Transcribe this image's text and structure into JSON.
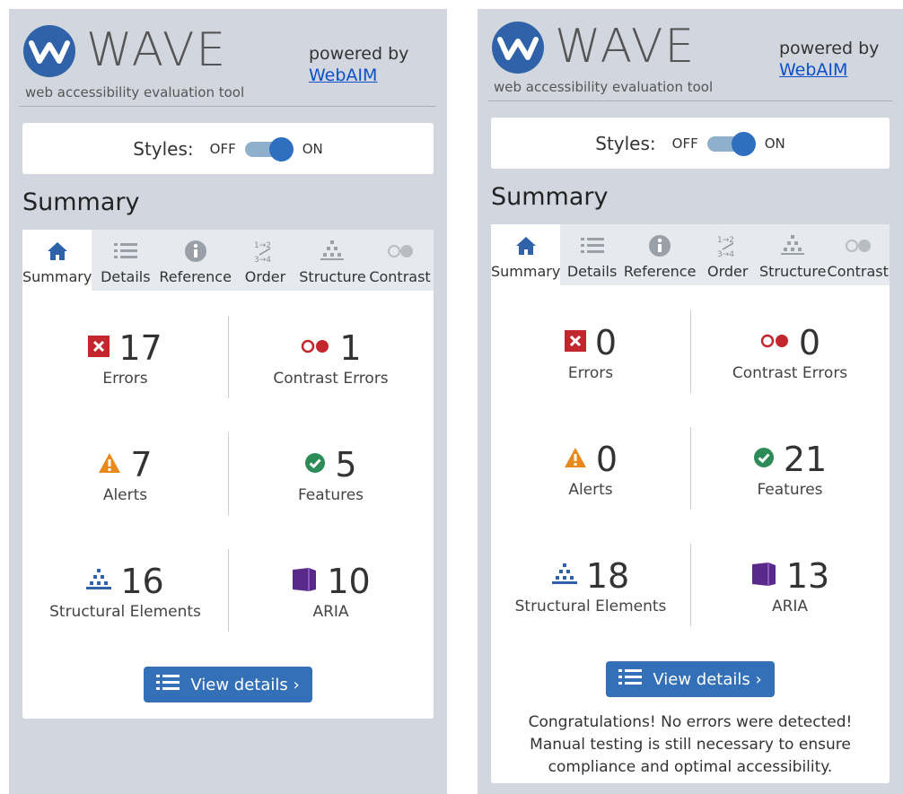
{
  "branding": {
    "logo_text": "WAVE",
    "tagline": "web accessibility evaluation tool",
    "powered_by": "powered by",
    "webaim_link": "WebAIM"
  },
  "styles_toggle": {
    "label": "Styles:",
    "off": "OFF",
    "on": "ON",
    "state": "on"
  },
  "summary_heading": "Summary",
  "tabs": [
    {
      "label": "Summary",
      "icon": "home-icon",
      "active": true
    },
    {
      "label": "Details",
      "icon": "list-icon"
    },
    {
      "label": "Reference",
      "icon": "info-icon"
    },
    {
      "label": "Order",
      "icon": "order-icon"
    },
    {
      "label": "Structure",
      "icon": "structure-icon"
    },
    {
      "label": "Contrast",
      "icon": "contrast-icon"
    }
  ],
  "colors": {
    "accent": "#3470b8",
    "error": "#c4262e",
    "alert": "#e8891d",
    "feature": "#2d8b57",
    "aria": "#5a2a8a",
    "structure": "#2f62a8"
  },
  "before": {
    "errors": {
      "count": "17",
      "label": "Errors"
    },
    "contrast": {
      "count": "1",
      "label": "Contrast Errors"
    },
    "alerts": {
      "count": "7",
      "label": "Alerts"
    },
    "features": {
      "count": "5",
      "label": "Features"
    },
    "structure": {
      "count": "16",
      "label": "Structural Elements"
    },
    "aria": {
      "count": "10",
      "label": "ARIA"
    },
    "button": "View details ›"
  },
  "after": {
    "errors": {
      "count": "0",
      "label": "Errors"
    },
    "contrast": {
      "count": "0",
      "label": "Contrast Errors"
    },
    "alerts": {
      "count": "0",
      "label": "Alerts"
    },
    "features": {
      "count": "21",
      "label": "Features"
    },
    "structure": {
      "count": "18",
      "label": "Structural Elements"
    },
    "aria": {
      "count": "13",
      "label": "ARIA"
    },
    "button": "View details ›",
    "message": "Congratulations! No errors were detected! Manual testing is still necessary to ensure compliance and optimal accessibility."
  }
}
